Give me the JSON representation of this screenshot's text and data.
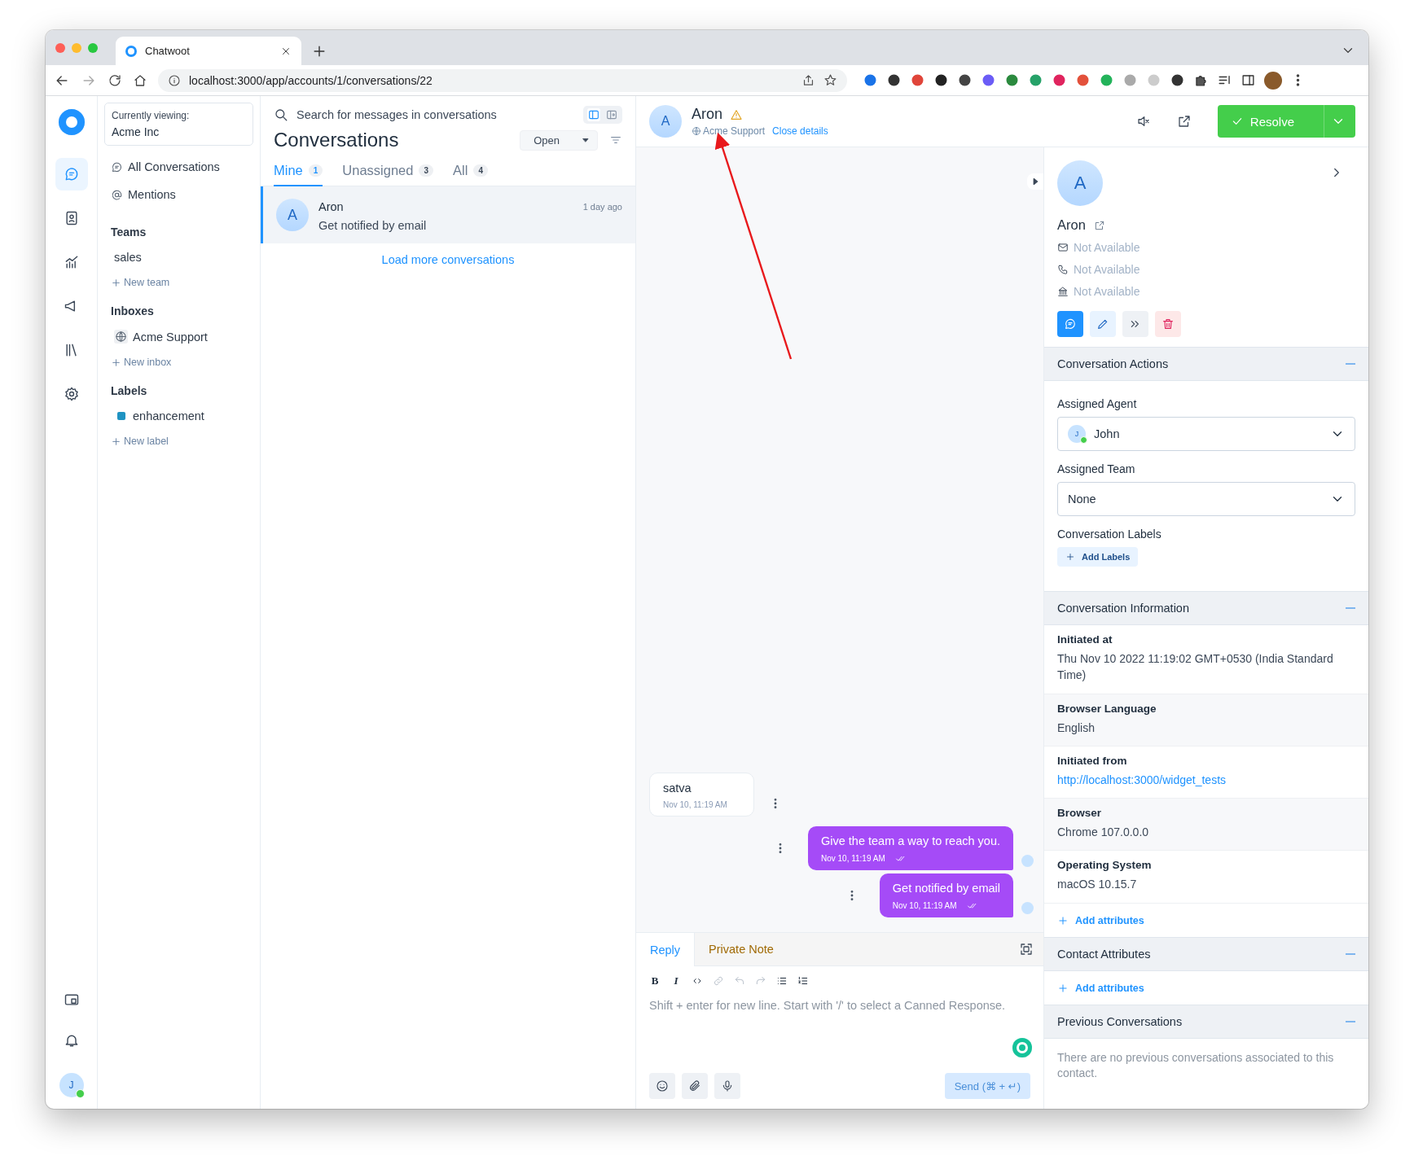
{
  "browser": {
    "tab_title": "Chatwoot",
    "url": "localhost:3000/app/accounts/1/conversations/22"
  },
  "rail": {
    "items": [
      {
        "kind": "conversations",
        "selected": true
      },
      {
        "kind": "contacts",
        "selected": false
      },
      {
        "kind": "reports",
        "selected": false
      },
      {
        "kind": "campaigns",
        "selected": false
      },
      {
        "kind": "library",
        "selected": false
      },
      {
        "kind": "settings",
        "selected": false
      }
    ],
    "user_initial": "J",
    "user_online": true
  },
  "sidebar": {
    "account_label": "Currently viewing:",
    "account_name": "Acme Inc",
    "views": [
      {
        "kind": "conversations",
        "label": "All Conversations"
      },
      {
        "kind": "mentions",
        "label": "Mentions"
      }
    ],
    "sections": [
      {
        "title": "Teams",
        "items": [
          {
            "kind": "team",
            "label": "sales"
          }
        ],
        "add": "New team"
      },
      {
        "title": "Inboxes",
        "items": [
          {
            "kind": "inbox",
            "label": "Acme Support"
          }
        ],
        "add": "New inbox"
      },
      {
        "title": "Labels",
        "items": [
          {
            "kind": "label",
            "label": "enhancement",
            "color": "#1f93c2"
          }
        ],
        "add": "New label"
      }
    ]
  },
  "conversation_list": {
    "search_placeholder": "Search for messages in conversations",
    "layout_views": [
      {
        "kind": "condensed",
        "selected": true
      },
      {
        "kind": "expanded",
        "selected": false
      }
    ],
    "title": "Conversations",
    "status_filter": "Open",
    "tabs": [
      {
        "label": "Mine",
        "count": "1",
        "selected": true
      },
      {
        "label": "Unassigned",
        "count": "3",
        "selected": false
      },
      {
        "label": "All",
        "count": "4",
        "selected": false
      }
    ],
    "conversations": [
      {
        "initial": "A",
        "name": "Aron",
        "preview": "Get notified by email",
        "time": "1 day ago",
        "selected": true
      }
    ],
    "load_more": "Load more conversations"
  },
  "chat": {
    "header": {
      "initial": "A",
      "name": "Aron",
      "warning": true,
      "inbox": "Acme Support",
      "close_details": "Close details",
      "resolve": "Resolve"
    },
    "messages": [
      {
        "kind": "incoming",
        "text": "satva",
        "time": "Nov 10, 11:19 AM"
      },
      {
        "kind": "outgoing",
        "text": "Give the team a way to reach you.",
        "time": "Nov 10, 11:19 AM"
      },
      {
        "kind": "outgoing",
        "text": "Get notified by email",
        "time": "Nov 10, 11:19 AM"
      }
    ],
    "composer": {
      "tabs": [
        {
          "label": "Reply",
          "selected": true
        },
        {
          "label": "Private Note",
          "selected": false
        }
      ],
      "toolbar": [
        {
          "kind": "bold",
          "label": "B",
          "disabled": false
        },
        {
          "kind": "italic",
          "label": "I",
          "disabled": false
        },
        {
          "kind": "code",
          "disabled": false
        },
        {
          "kind": "link",
          "disabled": true
        },
        {
          "kind": "undo",
          "disabled": true
        },
        {
          "kind": "redo",
          "disabled": true
        },
        {
          "kind": "bullet_list",
          "disabled": false
        },
        {
          "kind": "ordered_list",
          "disabled": false
        }
      ],
      "placeholder": "Shift + enter for new line. Start with '/' to select a Canned Response.",
      "send": "Send (⌘ + ↵)",
      "send_disabled": true
    }
  },
  "contact": {
    "initial": "A",
    "name": "Aron",
    "fields": [
      {
        "kind": "email",
        "text": "Not Available"
      },
      {
        "kind": "phone",
        "text": "Not Available"
      },
      {
        "kind": "company",
        "text": "Not Available"
      }
    ]
  },
  "sections": [
    {
      "kind": "actions",
      "title": "Conversation Actions",
      "expanded": true,
      "agent_label": "Assigned Agent",
      "agent": {
        "initial": "J",
        "name": "John",
        "online": true
      },
      "team_label": "Assigned Team",
      "team": "None",
      "labels_title": "Conversation Labels",
      "add_labels": "Add Labels"
    },
    {
      "kind": "info",
      "title": "Conversation Information",
      "expanded": true,
      "items": [
        {
          "label": "Initiated at",
          "value": "Thu Nov 10 2022 11:19:02 GMT+0530 (India Standard Time)",
          "link": false
        },
        {
          "label": "Browser Language",
          "value": "English",
          "link": false
        },
        {
          "label": "Initiated from",
          "value": "http://localhost:3000/widget_tests",
          "link": true
        },
        {
          "label": "Browser",
          "value": "Chrome 107.0.0.0",
          "link": false
        },
        {
          "label": "Operating System",
          "value": "macOS 10.15.7",
          "link": false
        }
      ],
      "add": "Add attributes"
    },
    {
      "kind": "attributes",
      "title": "Contact Attributes",
      "expanded": true,
      "add": "Add attributes"
    },
    {
      "kind": "previous",
      "title": "Previous Conversations",
      "expanded": true,
      "text": "There are no previous conversations associated to this contact."
    }
  ]
}
